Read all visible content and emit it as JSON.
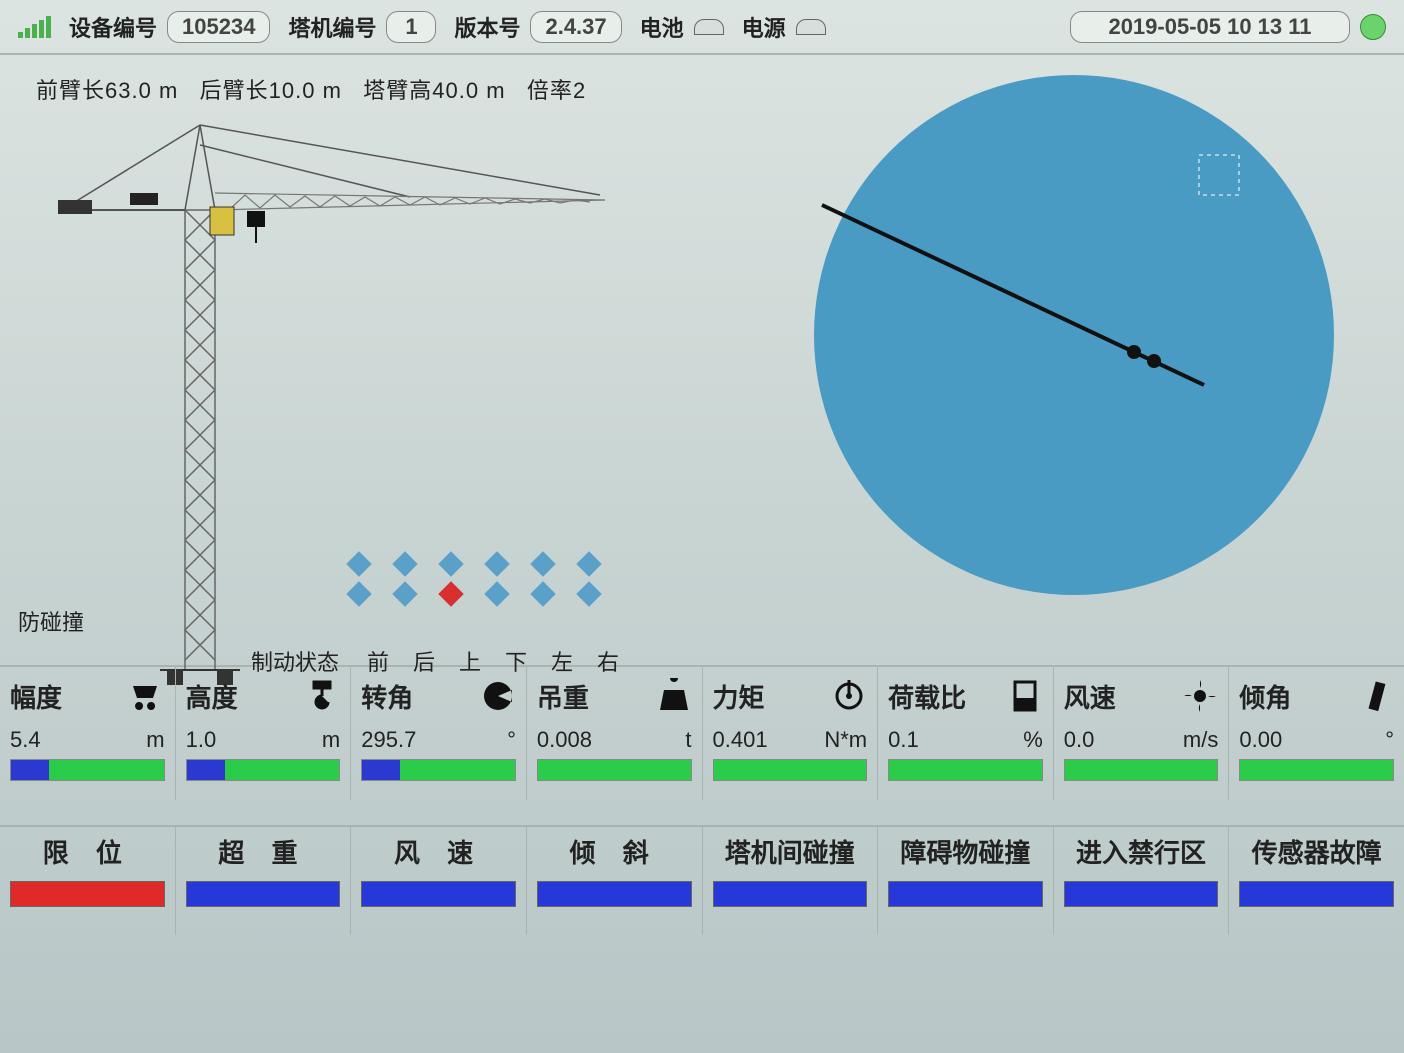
{
  "header": {
    "device_label": "设备编号",
    "device_value": "105234",
    "crane_label": "塔机编号",
    "crane_value": "1",
    "version_label": "版本号",
    "version_value": "2.4.37",
    "battery_label": "电池",
    "power_label": "电源",
    "datetime": "2019-05-05 10 13 11"
  },
  "specs": {
    "front_label": "前臂长",
    "front_value": "63.0",
    "back_label": "后臂长",
    "back_value": "10.0",
    "height_label": "塔臂高",
    "height_value": "40.0",
    "unit": "m",
    "mult_label": "倍率",
    "mult_value": "2"
  },
  "anticoll_label": "防碰撞",
  "brake": {
    "title": "制动状态",
    "cols": [
      "前",
      "后",
      "上",
      "下",
      "左",
      "右"
    ]
  },
  "metrics": [
    {
      "label": "幅度",
      "value": "5.4",
      "unit": "m",
      "icon": "trolley"
    },
    {
      "label": "高度",
      "value": "1.0",
      "unit": "m",
      "icon": "hook"
    },
    {
      "label": "转角",
      "value": "295.7",
      "unit": "°",
      "icon": "angle"
    },
    {
      "label": "吊重",
      "value": "0.008",
      "unit": "t",
      "icon": "weight"
    },
    {
      "label": "力矩",
      "value": "0.401",
      "unit": "N*m",
      "icon": "moment"
    },
    {
      "label": "荷载比",
      "value": "0.1",
      "unit": "%",
      "icon": "load"
    },
    {
      "label": "风速",
      "value": "0.0",
      "unit": "m/s",
      "icon": "wind"
    },
    {
      "label": "倾角",
      "value": "0.00",
      "unit": "°",
      "icon": "tilt"
    }
  ],
  "alarms": [
    {
      "label": "限  位",
      "state": "red"
    },
    {
      "label": "超  重",
      "state": "blue"
    },
    {
      "label": "风  速",
      "state": "blue"
    },
    {
      "label": "倾  斜",
      "state": "blue"
    },
    {
      "label": "塔机间碰撞",
      "state": "blue"
    },
    {
      "label": "障碍物碰撞",
      "state": "blue"
    },
    {
      "label": "进入禁行区",
      "state": "blue"
    },
    {
      "label": "传感器故障",
      "state": "blue"
    }
  ],
  "chart_data": {
    "type": "radial",
    "rotation_angle_deg": 295.7,
    "radius_m": 63.0
  }
}
